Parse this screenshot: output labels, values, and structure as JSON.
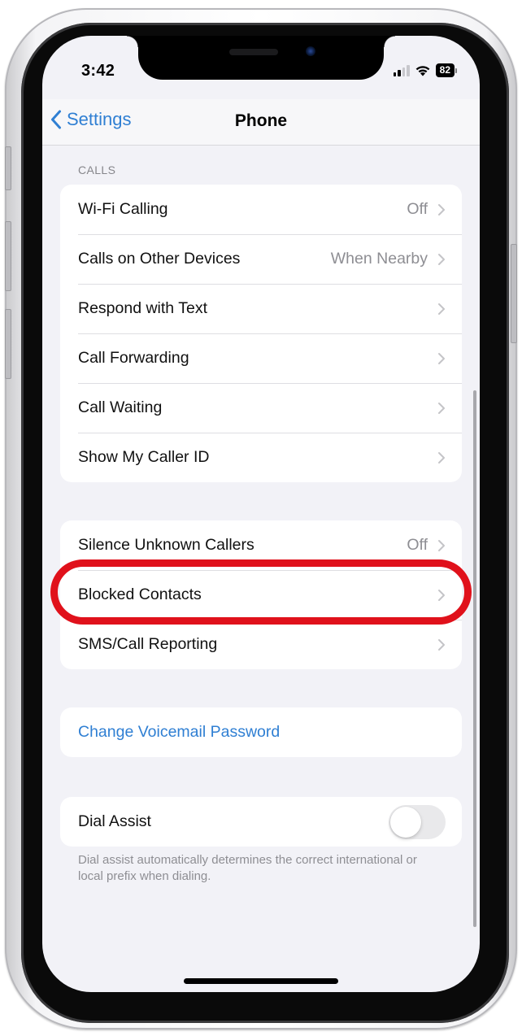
{
  "status_bar": {
    "time": "3:42",
    "signal_bars_active": 2,
    "signal_bars_total": 4,
    "wifi_icon": "wifi-icon",
    "battery_percent": "82"
  },
  "nav": {
    "back_label": "Settings",
    "back_icon": "chevron-left-icon",
    "title": "Phone"
  },
  "calls_section": {
    "header": "CALLS",
    "rows": [
      {
        "label": "Wi-Fi Calling",
        "value": "Off"
      },
      {
        "label": "Calls on Other Devices",
        "value": "When Nearby"
      },
      {
        "label": "Respond with Text",
        "value": ""
      },
      {
        "label": "Call Forwarding",
        "value": ""
      },
      {
        "label": "Call Waiting",
        "value": ""
      },
      {
        "label": "Show My Caller ID",
        "value": ""
      }
    ]
  },
  "blocking_section": {
    "rows": [
      {
        "label": "Silence Unknown Callers",
        "value": "Off"
      },
      {
        "label": "Blocked Contacts",
        "value": "",
        "highlighted": true
      },
      {
        "label": "SMS/Call Reporting",
        "value": ""
      }
    ],
    "highlight_color": "#e0111b"
  },
  "voicemail_section": {
    "link_label": "Change Voicemail Password",
    "link_color": "#2f7fd3"
  },
  "dial_assist_section": {
    "label": "Dial Assist",
    "toggle_on": false,
    "footer": "Dial assist automatically determines the correct international or local prefix when dialing."
  },
  "colors": {
    "accent": "#2f7fd3",
    "background": "#f2f2f7",
    "secondary_text": "#8e8e93"
  }
}
